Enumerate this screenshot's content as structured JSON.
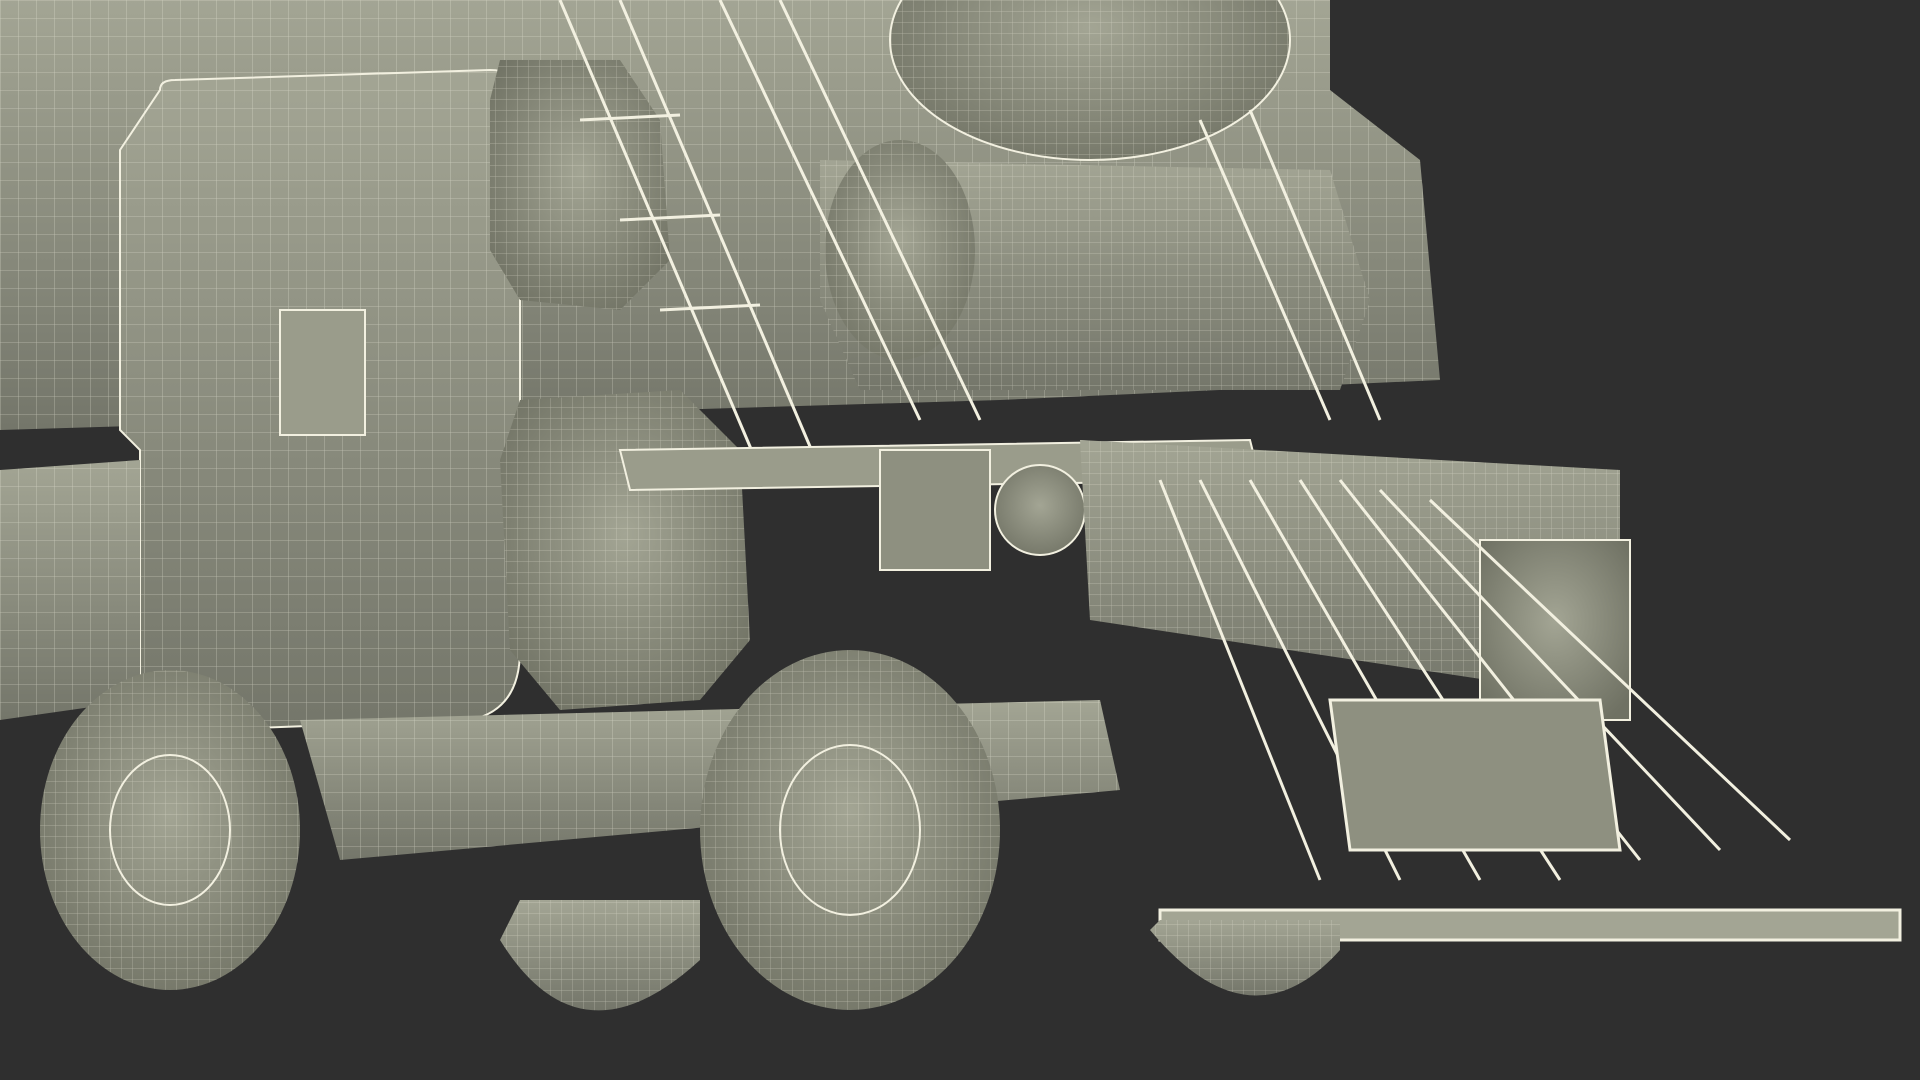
{
  "scene": {
    "subject": "steam-locomotive-wireframe-render",
    "colors": {
      "background": "#2f2f2f",
      "surface": "#8e9080",
      "surface_light": "#a3a594",
      "surface_dark": "#6f7163",
      "shadow": "#4e5046",
      "wire": "#f2f0e0"
    }
  }
}
